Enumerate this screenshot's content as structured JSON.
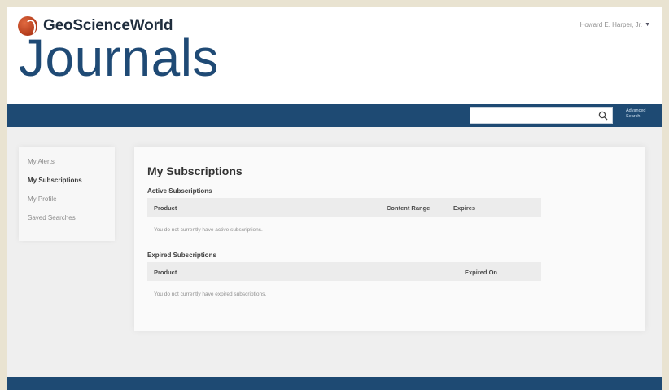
{
  "header": {
    "brand_name": "GeoScienceWorld",
    "user_name": "Howard E. Harper, Jr.",
    "user_caret": "▼",
    "section_title": "Journals"
  },
  "nav": {
    "search_placeholder": "",
    "advanced_search_label": "Advanced Search"
  },
  "sidebar": {
    "items": [
      {
        "label": "My Alerts",
        "active": false
      },
      {
        "label": "My Subscriptions",
        "active": true
      },
      {
        "label": "My Profile",
        "active": false
      },
      {
        "label": "Saved Searches",
        "active": false
      }
    ]
  },
  "main": {
    "title": "My Subscriptions",
    "active": {
      "heading": "Active Subscriptions",
      "columns": [
        "Product",
        "Content Range",
        "Expires"
      ],
      "empty_message": "You do not currently have active subscriptions."
    },
    "expired": {
      "heading": "Expired Subscriptions",
      "columns": [
        "Product",
        "Expired On"
      ],
      "empty_message": "You do not currently have expired subscriptions."
    }
  },
  "colors": {
    "brand_blue": "#1e4a73",
    "logo_orange": "#c8492a",
    "page_bg": "#efefef"
  }
}
